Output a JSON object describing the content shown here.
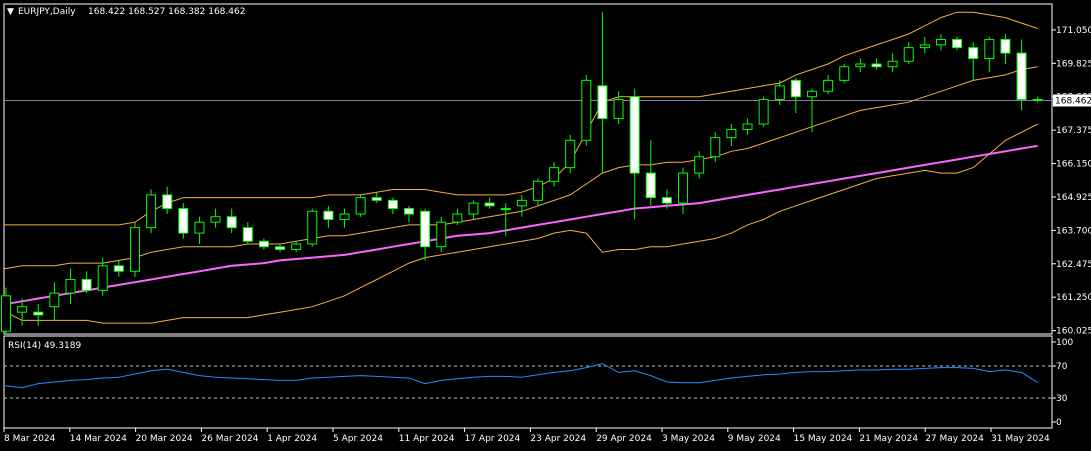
{
  "header": {
    "symbol": "EURJPY,Daily",
    "ohlc": "168.422 168.527 168.382 168.462"
  },
  "price_axis": {
    "ticks": [
      "171.050",
      "169.825",
      "168.600",
      "167.375",
      "166.150",
      "164.925",
      "163.700",
      "162.475",
      "161.250",
      "160.025"
    ],
    "current": "168.462"
  },
  "rsi": {
    "label": "RSI(14) 49.3189",
    "ticks": [
      "100",
      "70",
      "30",
      "0"
    ]
  },
  "date_axis": {
    "ticks": [
      "8 Mar 2024",
      "14 Mar 2024",
      "20 Mar 2024",
      "26 Mar 2024",
      "1 Apr 2024",
      "5 Apr 2024",
      "11 Apr 2024",
      "17 Apr 2024",
      "23 Apr 2024",
      "29 Apr 2024",
      "3 May 2024",
      "9 May 2024",
      "15 May 2024",
      "21 May 2024",
      "27 May 2024",
      "31 May 2024"
    ]
  },
  "colors": {
    "background": "#000000",
    "bull_wick": "#00ff00",
    "candle_body": "#ffffff",
    "bollinger": "#f5b041",
    "ma": "#ff66ff",
    "rsi_line": "#1e90ff",
    "current_price_line": "#8080a0",
    "level_line": "#c0c0c0"
  },
  "chart_data": [
    {
      "type": "candlestick",
      "title": "EURJPY,Daily",
      "ylim": [
        159.9,
        172.0
      ],
      "candles": [
        {
          "o": 160.0,
          "h": 161.6,
          "l": 159.9,
          "c": 161.3
        },
        {
          "o": 160.7,
          "h": 161.2,
          "l": 160.2,
          "c": 160.9
        },
        {
          "o": 160.7,
          "h": 161.0,
          "l": 160.2,
          "c": 160.6
        },
        {
          "o": 160.9,
          "h": 161.8,
          "l": 160.4,
          "c": 161.4
        },
        {
          "o": 161.4,
          "h": 162.3,
          "l": 161.0,
          "c": 161.9
        },
        {
          "o": 161.9,
          "h": 162.2,
          "l": 161.4,
          "c": 161.5
        },
        {
          "o": 161.5,
          "h": 162.7,
          "l": 161.3,
          "c": 162.4
        },
        {
          "o": 162.4,
          "h": 162.6,
          "l": 162.0,
          "c": 162.2
        },
        {
          "o": 162.2,
          "h": 164.0,
          "l": 162.0,
          "c": 163.8
        },
        {
          "o": 163.8,
          "h": 165.2,
          "l": 163.6,
          "c": 165.0
        },
        {
          "o": 165.0,
          "h": 165.3,
          "l": 164.3,
          "c": 164.5
        },
        {
          "o": 164.5,
          "h": 164.7,
          "l": 163.4,
          "c": 163.6
        },
        {
          "o": 163.6,
          "h": 164.2,
          "l": 163.2,
          "c": 164.0
        },
        {
          "o": 164.0,
          "h": 164.5,
          "l": 163.8,
          "c": 164.2
        },
        {
          "o": 164.2,
          "h": 164.5,
          "l": 163.6,
          "c": 163.8
        },
        {
          "o": 163.8,
          "h": 164.0,
          "l": 163.2,
          "c": 163.3
        },
        {
          "o": 163.3,
          "h": 163.4,
          "l": 163.0,
          "c": 163.1
        },
        {
          "o": 163.1,
          "h": 163.2,
          "l": 162.9,
          "c": 163.0
        },
        {
          "o": 163.0,
          "h": 163.3,
          "l": 162.9,
          "c": 163.2
        },
        {
          "o": 163.2,
          "h": 164.5,
          "l": 163.1,
          "c": 164.4
        },
        {
          "o": 164.4,
          "h": 164.6,
          "l": 163.8,
          "c": 164.1
        },
        {
          "o": 164.1,
          "h": 164.5,
          "l": 163.8,
          "c": 164.3
        },
        {
          "o": 164.3,
          "h": 165.0,
          "l": 164.2,
          "c": 164.9
        },
        {
          "o": 164.9,
          "h": 165.1,
          "l": 164.7,
          "c": 164.8
        },
        {
          "o": 164.8,
          "h": 164.9,
          "l": 164.3,
          "c": 164.5
        },
        {
          "o": 164.5,
          "h": 164.6,
          "l": 164.0,
          "c": 164.3
        },
        {
          "o": 164.4,
          "h": 164.5,
          "l": 162.6,
          "c": 163.1
        },
        {
          "o": 163.1,
          "h": 164.2,
          "l": 162.9,
          "c": 164.0
        },
        {
          "o": 164.0,
          "h": 164.5,
          "l": 163.9,
          "c": 164.3
        },
        {
          "o": 164.3,
          "h": 164.8,
          "l": 164.1,
          "c": 164.7
        },
        {
          "o": 164.7,
          "h": 164.9,
          "l": 164.5,
          "c": 164.6
        },
        {
          "o": 164.5,
          "h": 164.7,
          "l": 163.5,
          "c": 164.5
        },
        {
          "o": 164.6,
          "h": 165.0,
          "l": 164.2,
          "c": 164.8
        },
        {
          "o": 164.8,
          "h": 165.6,
          "l": 164.6,
          "c": 165.5
        },
        {
          "o": 165.5,
          "h": 166.2,
          "l": 165.3,
          "c": 166.0
        },
        {
          "o": 166.0,
          "h": 167.2,
          "l": 165.8,
          "c": 167.0
        },
        {
          "o": 167.0,
          "h": 169.4,
          "l": 166.8,
          "c": 169.2
        },
        {
          "o": 169.0,
          "h": 171.7,
          "l": 165.8,
          "c": 167.8
        },
        {
          "o": 167.8,
          "h": 168.8,
          "l": 167.6,
          "c": 168.5
        },
        {
          "o": 168.6,
          "h": 168.9,
          "l": 164.1,
          "c": 165.8
        },
        {
          "o": 165.8,
          "h": 167.0,
          "l": 164.6,
          "c": 164.9
        },
        {
          "o": 164.9,
          "h": 165.2,
          "l": 164.5,
          "c": 164.7
        },
        {
          "o": 164.7,
          "h": 166.0,
          "l": 164.3,
          "c": 165.8
        },
        {
          "o": 165.8,
          "h": 166.6,
          "l": 165.6,
          "c": 166.4
        },
        {
          "o": 166.4,
          "h": 167.3,
          "l": 166.2,
          "c": 167.1
        },
        {
          "o": 167.1,
          "h": 167.6,
          "l": 166.8,
          "c": 167.4
        },
        {
          "o": 167.4,
          "h": 167.8,
          "l": 167.2,
          "c": 167.6
        },
        {
          "o": 167.6,
          "h": 168.6,
          "l": 167.5,
          "c": 168.5
        },
        {
          "o": 168.5,
          "h": 169.2,
          "l": 168.3,
          "c": 169.0
        },
        {
          "o": 169.2,
          "h": 169.3,
          "l": 168.0,
          "c": 168.6
        },
        {
          "o": 168.6,
          "h": 168.9,
          "l": 167.3,
          "c": 168.8
        },
        {
          "o": 168.8,
          "h": 169.4,
          "l": 168.7,
          "c": 169.2
        },
        {
          "o": 169.2,
          "h": 169.8,
          "l": 169.1,
          "c": 169.7
        },
        {
          "o": 169.7,
          "h": 170.0,
          "l": 169.5,
          "c": 169.8
        },
        {
          "o": 169.8,
          "h": 170.0,
          "l": 169.6,
          "c": 169.7
        },
        {
          "o": 169.7,
          "h": 170.2,
          "l": 169.5,
          "c": 169.9
        },
        {
          "o": 169.9,
          "h": 170.6,
          "l": 169.8,
          "c": 170.4
        },
        {
          "o": 170.4,
          "h": 170.8,
          "l": 170.2,
          "c": 170.5
        },
        {
          "o": 170.5,
          "h": 170.9,
          "l": 170.3,
          "c": 170.7
        },
        {
          "o": 170.7,
          "h": 170.8,
          "l": 170.3,
          "c": 170.4
        },
        {
          "o": 170.4,
          "h": 170.6,
          "l": 169.2,
          "c": 170.0
        },
        {
          "o": 170.0,
          "h": 170.8,
          "l": 169.5,
          "c": 170.7
        },
        {
          "o": 170.7,
          "h": 170.9,
          "l": 169.8,
          "c": 170.2
        },
        {
          "o": 170.2,
          "h": 170.7,
          "l": 168.1,
          "c": 168.5
        },
        {
          "o": 168.5,
          "h": 168.6,
          "l": 168.4,
          "c": 168.462
        }
      ],
      "bollinger": {
        "upper": [
          163.9,
          163.9,
          163.9,
          163.9,
          163.9,
          163.9,
          163.9,
          163.9,
          164.0,
          164.4,
          164.7,
          164.9,
          164.9,
          164.9,
          164.9,
          164.9,
          164.9,
          164.9,
          164.9,
          164.9,
          165.0,
          165.0,
          165.0,
          165.1,
          165.2,
          165.2,
          165.2,
          165.1,
          165.0,
          165.0,
          165.0,
          165.0,
          165.1,
          165.3,
          165.6,
          166.2,
          167.3,
          168.4,
          168.6,
          168.6,
          168.6,
          168.6,
          168.6,
          168.6,
          168.7,
          168.8,
          168.9,
          169.0,
          169.1,
          169.4,
          169.6,
          169.8,
          170.1,
          170.3,
          170.5,
          170.7,
          170.9,
          171.2,
          171.5,
          171.7,
          171.7,
          171.6,
          171.5,
          171.3,
          171.1
        ],
        "middle": [
          162.3,
          162.4,
          162.4,
          162.4,
          162.5,
          162.5,
          162.5,
          162.6,
          162.7,
          162.9,
          163.0,
          163.1,
          163.1,
          163.1,
          163.1,
          163.2,
          163.2,
          163.2,
          163.3,
          163.4,
          163.5,
          163.5,
          163.6,
          163.7,
          163.8,
          163.9,
          163.9,
          163.9,
          164.0,
          164.1,
          164.2,
          164.3,
          164.4,
          164.6,
          164.8,
          165.0,
          165.4,
          165.8,
          166.0,
          166.1,
          166.1,
          166.2,
          166.2,
          166.3,
          166.4,
          166.6,
          166.7,
          166.9,
          167.1,
          167.3,
          167.5,
          167.7,
          167.9,
          168.1,
          168.2,
          168.3,
          168.4,
          168.6,
          168.8,
          169.0,
          169.2,
          169.3,
          169.4,
          169.6,
          169.7
        ],
        "lower": [
          160.7,
          160.4,
          160.4,
          160.4,
          160.4,
          160.4,
          160.3,
          160.3,
          160.3,
          160.3,
          160.4,
          160.5,
          160.5,
          160.5,
          160.5,
          160.5,
          160.6,
          160.7,
          160.8,
          160.9,
          161.1,
          161.3,
          161.6,
          161.9,
          162.2,
          162.5,
          162.7,
          162.8,
          162.9,
          163.0,
          163.1,
          163.2,
          163.3,
          163.4,
          163.6,
          163.7,
          163.6,
          162.9,
          163.0,
          163.0,
          163.1,
          163.1,
          163.2,
          163.3,
          163.4,
          163.6,
          163.9,
          164.1,
          164.4,
          164.6,
          164.8,
          165.0,
          165.2,
          165.4,
          165.6,
          165.7,
          165.8,
          165.9,
          165.8,
          165.8,
          166.0,
          166.5,
          167.0,
          167.3,
          167.6
        ]
      },
      "ma": [
        161.0,
        161.1,
        161.2,
        161.3,
        161.4,
        161.5,
        161.6,
        161.7,
        161.8,
        161.9,
        162.0,
        162.1,
        162.2,
        162.3,
        162.4,
        162.45,
        162.5,
        162.6,
        162.65,
        162.7,
        162.75,
        162.8,
        162.9,
        163.0,
        163.1,
        163.2,
        163.3,
        163.4,
        163.5,
        163.55,
        163.6,
        163.7,
        163.8,
        163.9,
        164.0,
        164.1,
        164.2,
        164.3,
        164.4,
        164.5,
        164.55,
        164.6,
        164.65,
        164.7,
        164.8,
        164.9,
        165.0,
        165.1,
        165.2,
        165.3,
        165.4,
        165.5,
        165.6,
        165.7,
        165.8,
        165.9,
        166.0,
        166.1,
        166.2,
        166.3,
        166.4,
        166.5,
        166.6,
        166.7,
        166.8
      ]
    },
    {
      "type": "line",
      "title": "RSI(14) 49.3189",
      "ylim": [
        0,
        100
      ],
      "levels": [
        70,
        30
      ],
      "values": [
        45,
        43,
        48,
        50,
        52,
        53,
        55,
        56,
        60,
        64,
        66,
        62,
        58,
        56,
        55,
        54,
        53,
        52,
        52,
        55,
        56,
        57,
        58,
        57,
        56,
        55,
        48,
        52,
        54,
        56,
        57,
        57,
        56,
        59,
        62,
        64,
        68,
        73,
        62,
        64,
        58,
        50,
        49,
        49,
        52,
        55,
        57,
        59,
        60,
        62,
        63,
        63,
        64,
        65,
        65,
        66,
        66,
        67,
        68,
        68,
        67,
        63,
        65,
        62,
        49.3
      ]
    }
  ]
}
